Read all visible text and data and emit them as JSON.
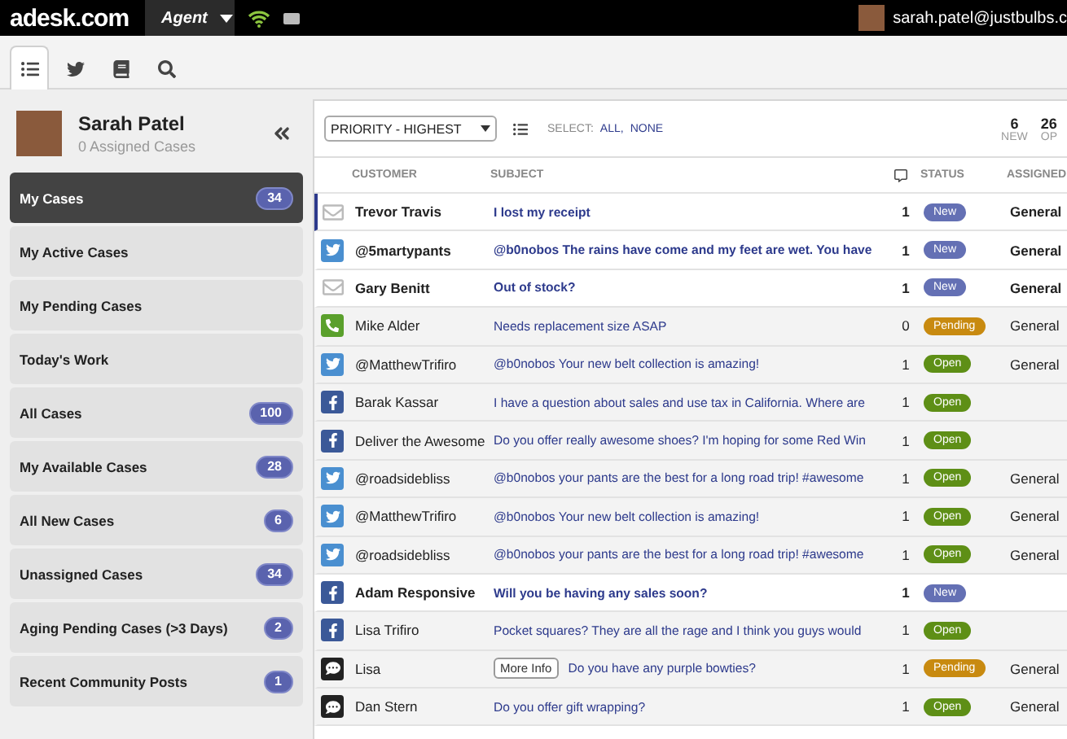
{
  "top_bar": {
    "logo": "adesk.com",
    "role_menu": "Agent",
    "user_email": "sarah.patel@justbulbs.c"
  },
  "tabs": [
    {
      "kind": "list",
      "selected": true
    },
    {
      "kind": "bird",
      "selected": false
    },
    {
      "kind": "book",
      "selected": false
    },
    {
      "kind": "search",
      "selected": false
    }
  ],
  "profile": {
    "name": "Sarah Patel",
    "subtitle": "0 Assigned Cases"
  },
  "sidebar": {
    "items": [
      {
        "label": "My Cases",
        "count": "34",
        "selected": true
      },
      {
        "label": "My Active Cases",
        "selected": false
      },
      {
        "label": "My Pending Cases",
        "selected": false
      },
      {
        "label": "Today's Work",
        "selected": false
      },
      {
        "label": "All Cases",
        "count": "100",
        "selected": false
      },
      {
        "label": "My Available Cases",
        "count": "28",
        "selected": false
      },
      {
        "label": "All New Cases",
        "count": "6",
        "selected": false
      },
      {
        "label": "Unassigned Cases",
        "count": "34",
        "selected": false
      },
      {
        "label": "Aging Pending Cases (>3 Days)",
        "count": "2",
        "selected": false
      },
      {
        "label": "Recent Community Posts",
        "count": "1",
        "selected": false
      }
    ]
  },
  "toolbar": {
    "sort": "PRIORITY - HIGHEST",
    "select_label": "SELECT:",
    "select_all": "ALL,",
    "select_none": "NONE",
    "stats": [
      {
        "value": "6",
        "label": "NEW"
      },
      {
        "value": "26",
        "label": "OP"
      }
    ]
  },
  "table": {
    "columns": [
      "CUSTOMER",
      "SUBJECT",
      "STATUS",
      "ASSIGNED"
    ],
    "rows": [
      {
        "kind": "email",
        "customer": "Trevor Travis",
        "subject": "I lost my receipt",
        "count": "1",
        "status": "New",
        "color": "#6470b4",
        "assigned": "General",
        "unread": true,
        "selected": true
      },
      {
        "kind": "twitter",
        "customer": "@5martypants",
        "subject": "@b0nobos The rains have come and my feet are wet. You have",
        "count": "1",
        "status": "New",
        "color": "#6470b4",
        "assigned": "General",
        "unread": true,
        "selected": false
      },
      {
        "kind": "email",
        "customer": "Gary Benitt",
        "subject": "Out of stock?",
        "count": "1",
        "status": "New",
        "color": "#6470b4",
        "assigned": "General",
        "unread": true,
        "selected": false
      },
      {
        "kind": "phone",
        "customer": "Mike Alder",
        "subject": "Needs replacement size ASAP",
        "count": "0",
        "status": "Pending",
        "color": "#c88a10",
        "assigned": "General",
        "unread": false,
        "selected": false
      },
      {
        "kind": "twitter",
        "customer": "@MatthewTrifiro",
        "subject": "@b0nobos Your new belt collection is amazing!",
        "count": "1",
        "status": "Open",
        "color": "#5e8f16",
        "assigned": "General",
        "unread": false,
        "selected": false
      },
      {
        "kind": "facebook",
        "customer": "Barak Kassar",
        "subject": "I have a question about sales and use tax in California. Where are",
        "count": "1",
        "status": "Open",
        "color": "#5e8f16",
        "unread": false,
        "selected": false
      },
      {
        "kind": "facebook",
        "customer": "Deliver the Awesome",
        "subject": "Do you offer really awesome shoes? I'm hoping for some Red Win",
        "count": "1",
        "status": "Open",
        "color": "#5e8f16",
        "unread": false,
        "selected": false
      },
      {
        "kind": "twitter",
        "customer": "@roadsidebliss",
        "subject": "@b0nobos your pants are the best for a long road trip! #awesome",
        "count": "1",
        "status": "Open",
        "color": "#5e8f16",
        "assigned": "General",
        "unread": false,
        "selected": false
      },
      {
        "kind": "twitter",
        "customer": "@MatthewTrifiro",
        "subject": "@b0nobos Your new belt collection is amazing!",
        "count": "1",
        "status": "Open",
        "color": "#5e8f16",
        "assigned": "General",
        "unread": false,
        "selected": false
      },
      {
        "kind": "twitter",
        "customer": "@roadsidebliss",
        "subject": "@b0nobos your pants are the best for a long road trip! #awesome",
        "count": "1",
        "status": "Open",
        "color": "#5e8f16",
        "assigned": "General",
        "unread": false,
        "selected": false
      },
      {
        "kind": "facebook",
        "customer": "Adam Responsive",
        "subject": "Will you be having any sales soon?",
        "count": "1",
        "status": "New",
        "color": "#6470b4",
        "unread": true,
        "selected": false
      },
      {
        "kind": "facebook",
        "customer": "Lisa Trifiro",
        "subject": "Pocket squares? They are all the rage and I think you guys would",
        "count": "1",
        "status": "Open",
        "color": "#5e8f16",
        "unread": false,
        "selected": false
      },
      {
        "kind": "chat",
        "customer": "Lisa",
        "more_info": "More Info",
        "subject": "Do you have any purple bowties?",
        "count": "1",
        "status": "Pending",
        "color": "#c88a10",
        "assigned": "General",
        "unread": false,
        "selected": false
      },
      {
        "kind": "chat",
        "customer": "Dan Stern",
        "subject": "Do you offer gift wrapping?",
        "count": "1",
        "status": "Open",
        "color": "#5e8f16",
        "assigned": "General",
        "unread": false,
        "selected": false
      }
    ]
  }
}
